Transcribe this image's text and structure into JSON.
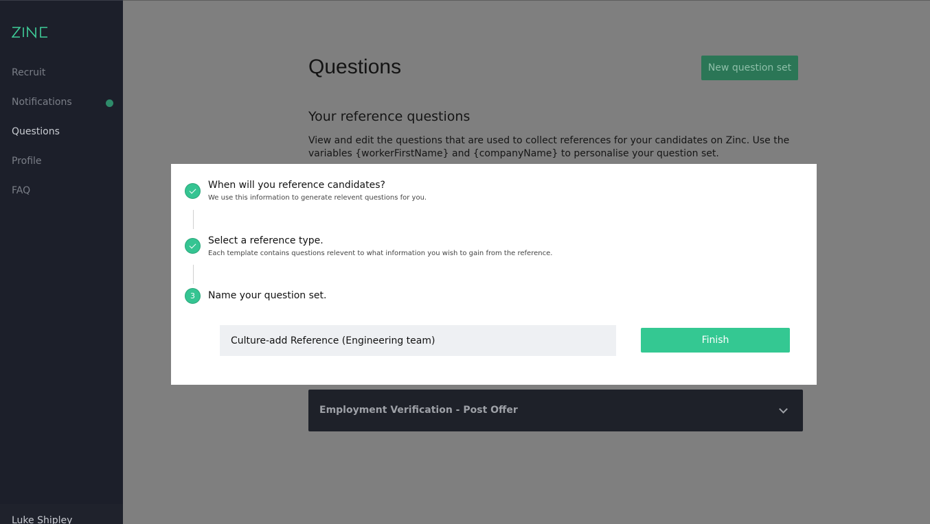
{
  "sidebar": {
    "logo_text": "ZINC",
    "items": [
      {
        "label": "Recruit"
      },
      {
        "label": "Notifications"
      },
      {
        "label": "Questions"
      },
      {
        "label": "Profile"
      },
      {
        "label": "FAQ"
      }
    ],
    "user_name": "Luke Shipley"
  },
  "main": {
    "title": "Questions",
    "new_set_label": "New question set",
    "section_title": "Your reference questions",
    "section_desc": "View and edit the questions that are used to collect references for your candidates on Zinc. Use the variables {workerFirstName} and {companyName} to personalise your question set.",
    "accordion_label": "Employment Verification - Post Offer"
  },
  "modal": {
    "steps": [
      {
        "title": "When will you reference candidates?",
        "subtitle": "We use this information to generate relevent questions for you."
      },
      {
        "title": "Select a reference type.",
        "subtitle": "Each template contains questions relevent to what information you wish to gain from the reference."
      },
      {
        "number": "3",
        "title": "Name your question set."
      }
    ],
    "name_input_value": "Culture-add Reference (Engineering team)",
    "finish_label": "Finish"
  },
  "colors": {
    "accent": "#34c892",
    "sidebar_bg": "#1c1f2a"
  }
}
